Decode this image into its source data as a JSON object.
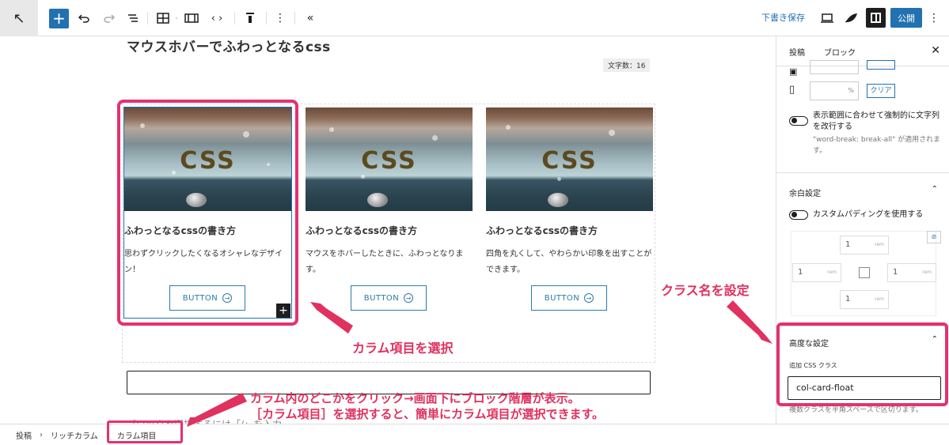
{
  "toolbar": {
    "draft_label": "下書き保存",
    "publish_label": "公開"
  },
  "editor": {
    "post_title": "マウスホバーでふわっとなるcss",
    "word_count": "文字数：16",
    "cards": [
      {
        "image_text": "CSS",
        "title": "ふわっとなるcssの書き方",
        "text": "思わずクリックしたくなるオシャレなデザイン！",
        "button": "BUTTON"
      },
      {
        "image_text": "CSS",
        "title": "ふわっとなるcssの書き方",
        "text": "マウスをホバーしたときに、ふわっとなります。",
        "button": "BUTTON"
      },
      {
        "image_text": "CSS",
        "title": "ふわっとなるcssの書き方",
        "text": "四角を丸くして、やわらかい印象を出すことができます。",
        "button": "BUTTON"
      }
    ],
    "placeholder": "ブロックを選択するには「/」を入力"
  },
  "annotations": {
    "select_column": "カラム項目を選択",
    "set_class": "クラス名を設定",
    "note_line1": "カラム内のどこかをクリック→画面下にブロック階層が表示。",
    "note_line2": "［カラム項目］を選択すると、簡単にカラム項目が選択できます。",
    "accent_color": "#e0315f"
  },
  "breadcrumb": {
    "items": [
      "投稿",
      "リッチカラム",
      "カラム項目"
    ]
  },
  "sidebar": {
    "tabs": [
      "投稿",
      "ブロック"
    ],
    "percent_unit": "%",
    "clear_label": "クリア",
    "wordbreak_label": "表示範囲に合わせて強制的に文字列を改行する",
    "wordbreak_note": "\"word-break: break-all\" が適用されます。",
    "margin_section": "余白設定",
    "custom_padding_label": "カスタムパディングを使用する",
    "padding_values": {
      "top": "1",
      "left": "1",
      "right": "1",
      "bottom": "1"
    },
    "padding_unit": "rem",
    "advanced_section": "高度な設定",
    "css_class_label": "追加 CSS クラス",
    "css_class_value": "col-card-float",
    "css_class_help": "複数クラスを半角スペースで区切ります。"
  }
}
